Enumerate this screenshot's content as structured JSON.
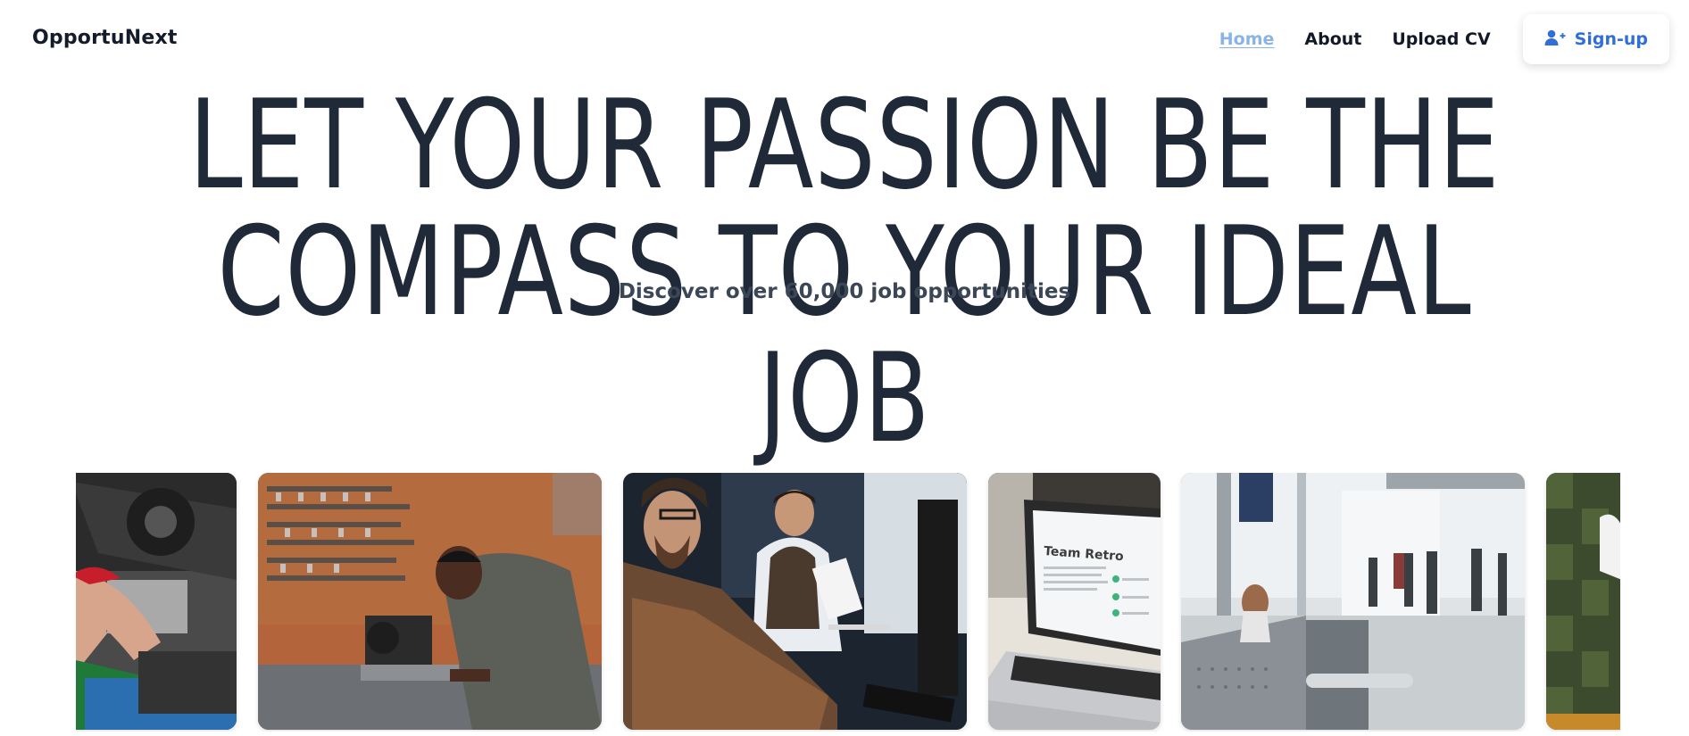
{
  "brand": "OpportuNext",
  "nav": {
    "home": "Home",
    "about": "About",
    "upload": "Upload CV",
    "signup": "Sign-up"
  },
  "hero": {
    "line1": "LET YOUR PASSION BE THE",
    "line2": "COMPASS TO YOUR IDEAL JOB",
    "subtitle": "Discover over 60,000 job opportunities"
  },
  "gallery": {
    "card4_text": "Team Retro"
  },
  "colors": {
    "accent": "#2f6fd7",
    "active_link": "#8ab4e6",
    "headline": "#1f2937"
  },
  "icons": {
    "signup": "user-plus-icon"
  }
}
